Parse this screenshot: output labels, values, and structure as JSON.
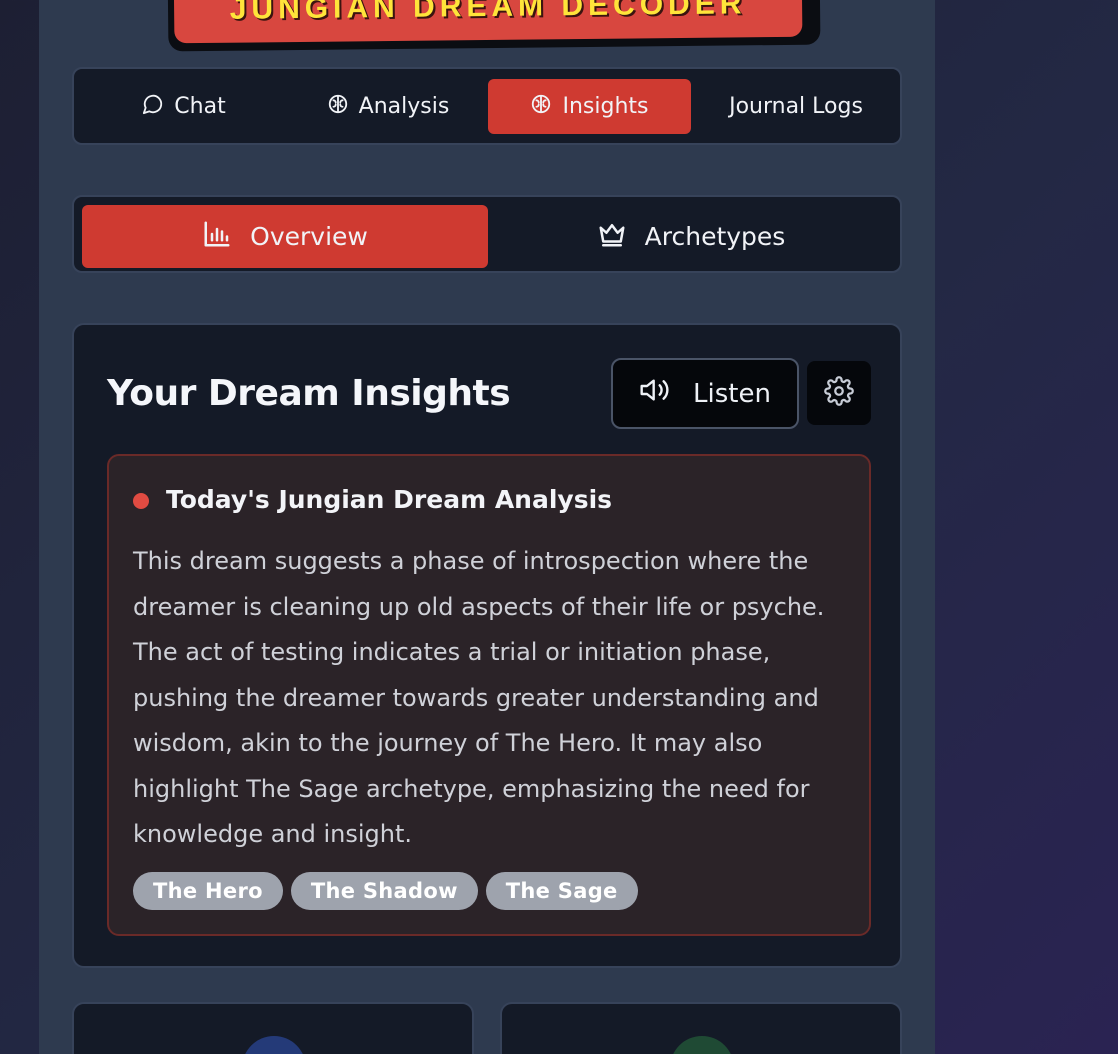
{
  "app": {
    "title": "JUNGIAN DREAM DECODER"
  },
  "main_nav": {
    "items": [
      {
        "label": "Chat",
        "icon": "chat-bubble-icon",
        "active": false
      },
      {
        "label": "Analysis",
        "icon": "brain-icon",
        "active": false
      },
      {
        "label": "Insights",
        "icon": "brain-icon",
        "active": true
      },
      {
        "label": "Journal Logs",
        "icon": "",
        "active": false
      }
    ]
  },
  "sub_nav": {
    "items": [
      {
        "label": "Overview",
        "icon": "bar-chart-icon",
        "active": true
      },
      {
        "label": "Archetypes",
        "icon": "crown-icon",
        "active": false
      }
    ]
  },
  "insights": {
    "title": "Your Dream Insights",
    "listen_label": "Listen",
    "listen_icon": "speaker-icon",
    "settings_icon": "gear-icon",
    "analysis": {
      "title": "Today's Jungian Dream Analysis",
      "body": "This dream suggests a phase of introspection where the dreamer is cleaning up old aspects of their life or psyche. The act of testing indicates a trial or initiation phase, pushing the dreamer towards greater understanding and wisdom, akin to the journey of The Hero. It may also highlight The Sage archetype, emphasizing the need for knowledge and insight.",
      "archetypes": [
        "The Hero",
        "The Shadow",
        "The Sage"
      ]
    }
  },
  "colors": {
    "accent": "#cf3a31",
    "panel": "#141a27",
    "banner_text": "#ffe43a",
    "analysis_dot": "#e04b42",
    "tag_bg": "#9ea3ad"
  }
}
